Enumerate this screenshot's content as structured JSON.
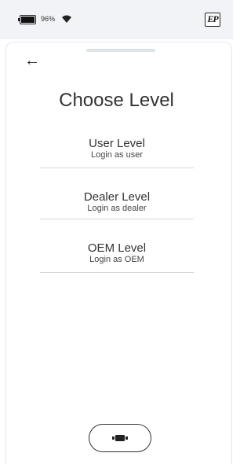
{
  "status": {
    "battery_percent": "96%",
    "battery_level": 0.96,
    "wifi_icon": "wifi-icon"
  },
  "logo": {
    "text": "EP"
  },
  "header": {
    "back_icon": "←",
    "title": "Choose Level"
  },
  "levels": [
    {
      "name": "User Level",
      "subtitle": "Login as user"
    },
    {
      "name": "Dealer Level",
      "subtitle": "Login as dealer"
    },
    {
      "name": "OEM Level",
      "subtitle": "Login as OEM"
    }
  ]
}
